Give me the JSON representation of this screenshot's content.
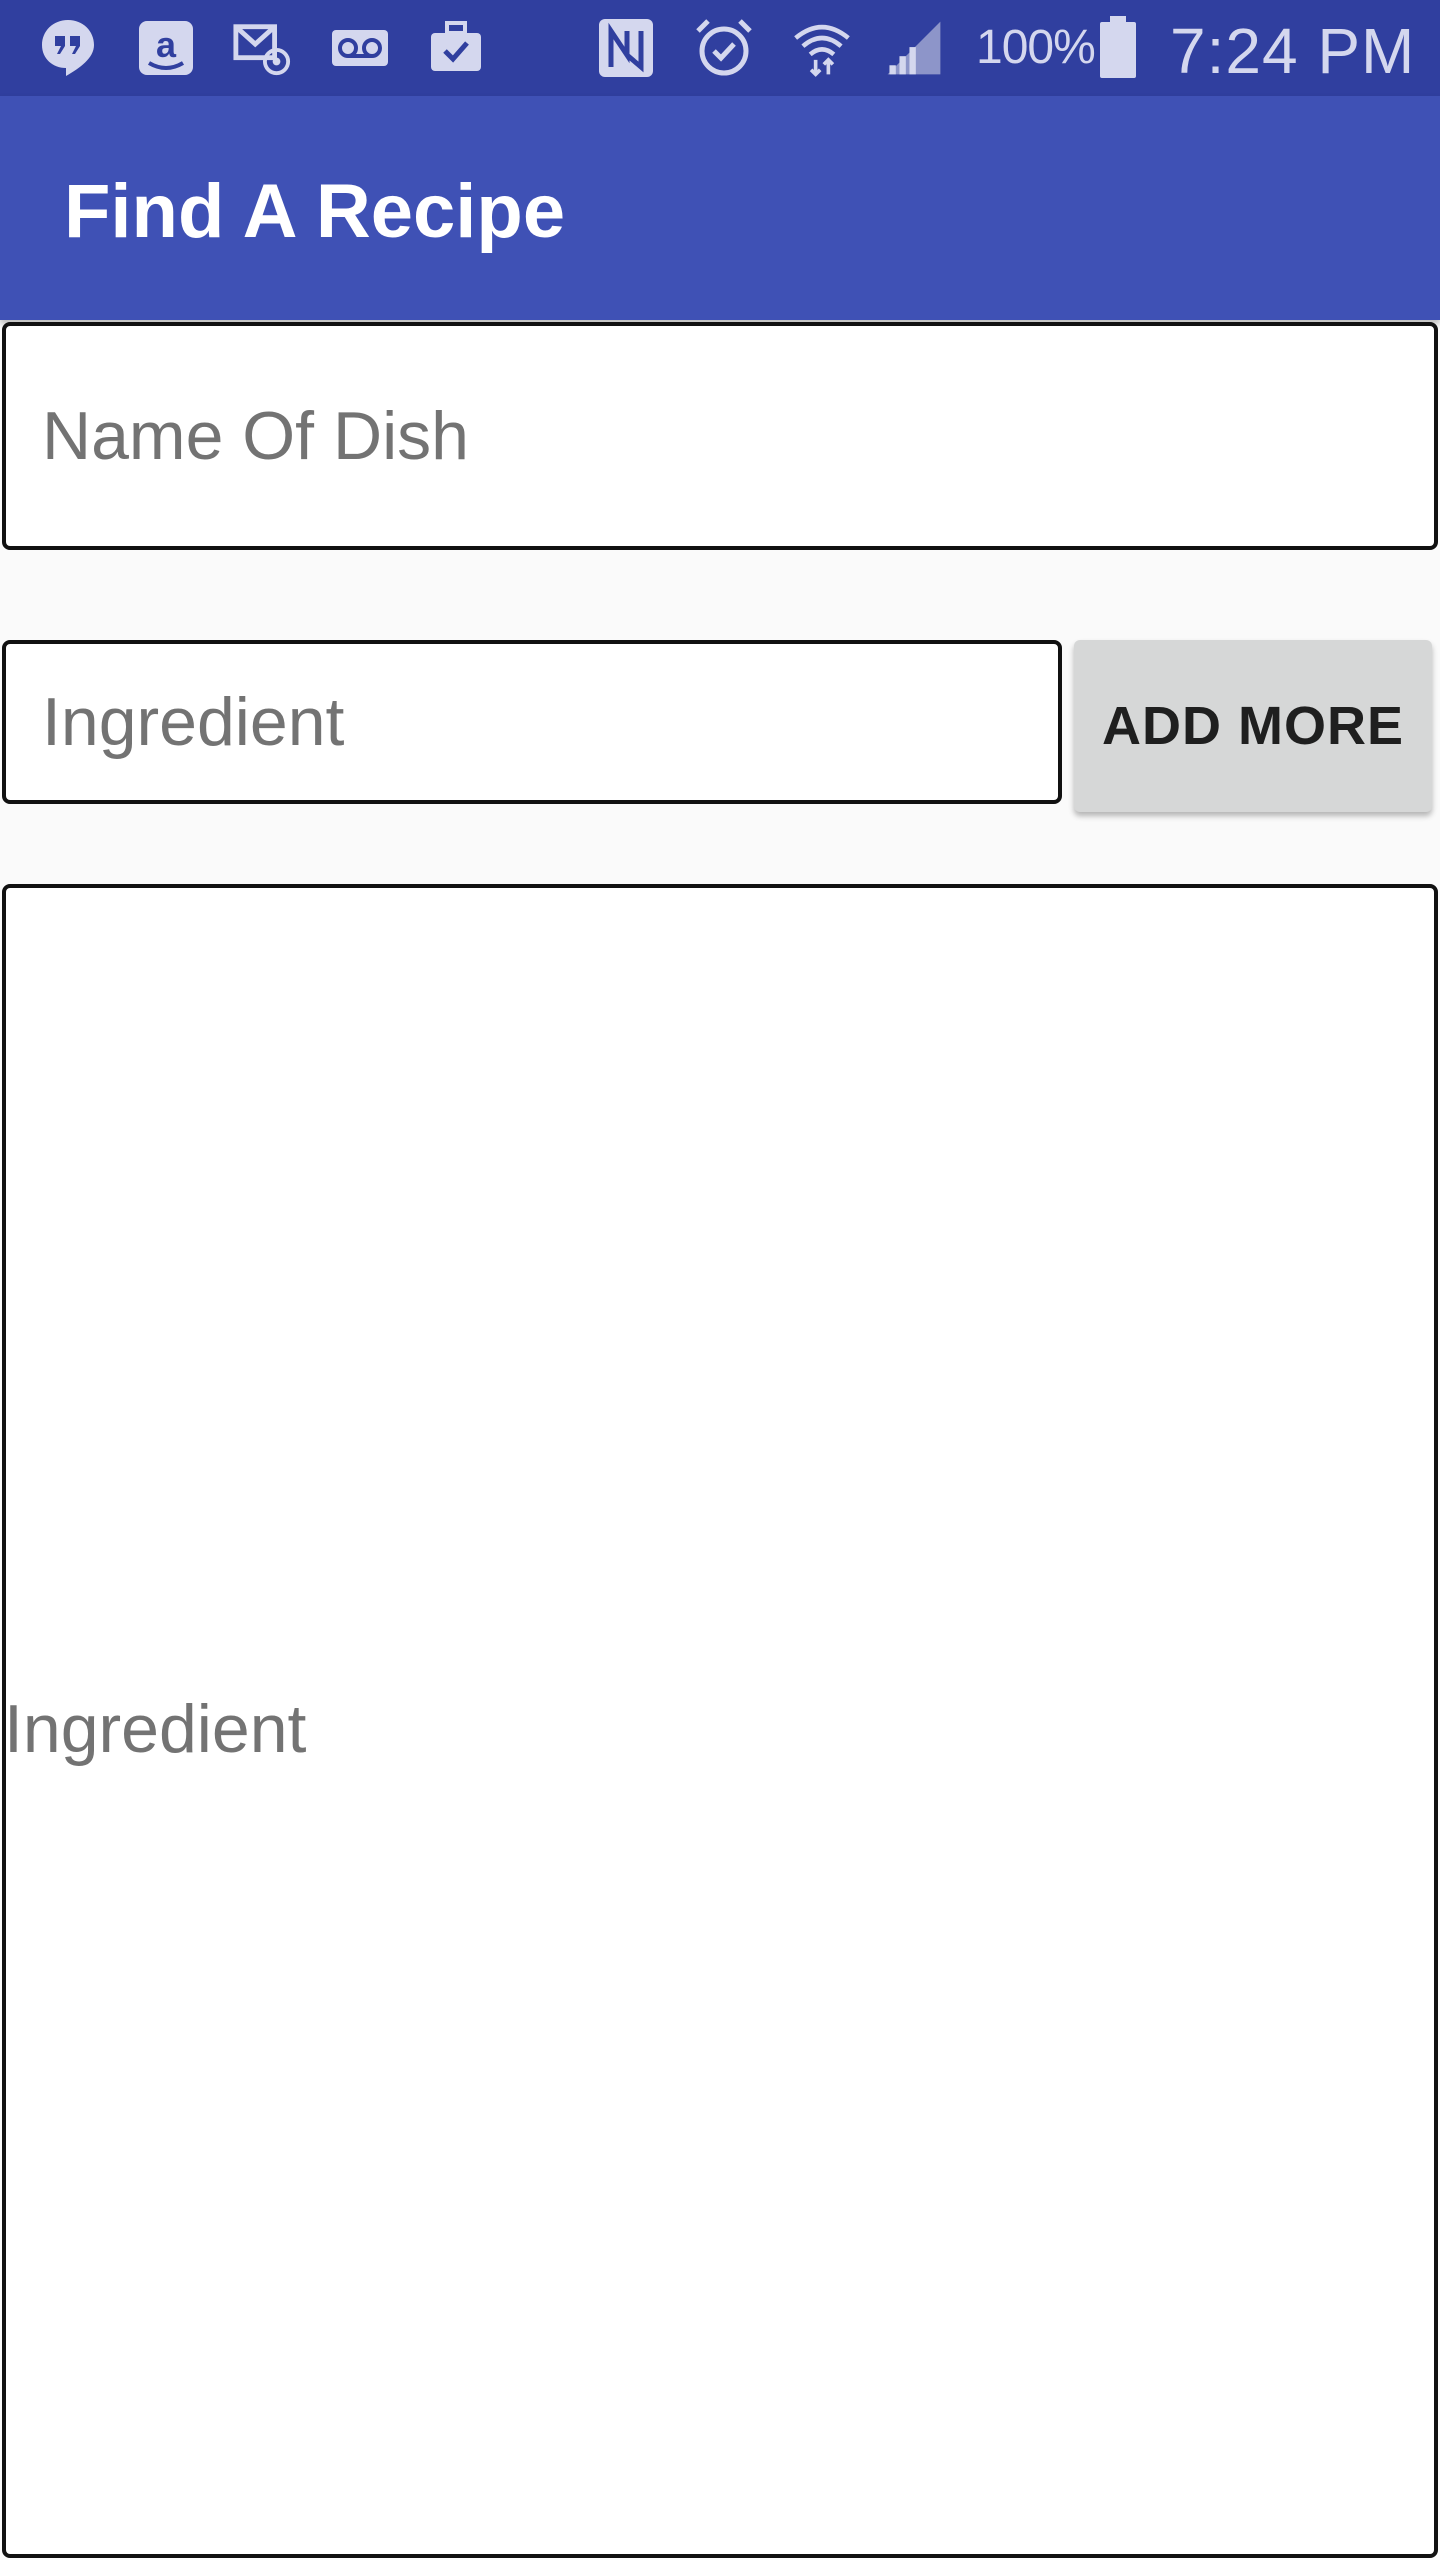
{
  "status_bar": {
    "icons": [
      "hangouts-icon",
      "amazon-icon",
      "email-icon",
      "voicemail-icon",
      "work-briefcase-icon",
      "nfc-icon",
      "alarm-icon",
      "wifi-icon",
      "signal-icon",
      "battery-icon"
    ],
    "battery_percent": "100%",
    "time": "7:24 PM"
  },
  "app_bar": {
    "title": "Find A Recipe",
    "color": "#3f51b5",
    "status_color": "#303f9f"
  },
  "form": {
    "dish_placeholder": "Name Of Dish",
    "ingredient_placeholder": "Ingredient",
    "add_more_label": "ADD MORE"
  },
  "ingredient_list": {
    "text": "Ingredient"
  }
}
